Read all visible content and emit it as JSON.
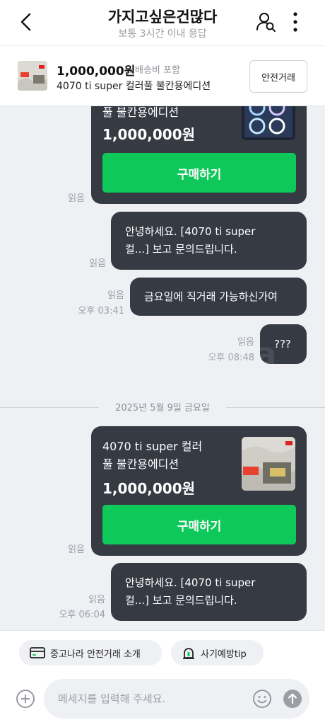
{
  "header": {
    "title": "가지고싶은건많다",
    "subtitle": "보통 3시간 이내 응답"
  },
  "product": {
    "price": "1,000,000원",
    "shipping": "배송비 포함",
    "title": "4070 ti super 컬러풀 불칸용에디션",
    "safe_button": "안전거래"
  },
  "messages": {
    "card1": {
      "name_line2": "풀 불칸용에디션",
      "price": "1,000,000원",
      "buy": "구매하기",
      "read": "읽음"
    },
    "msg1": {
      "line1": "안녕하세요. [4070 ti super",
      "line2": "컬...] 보고 문의드립니다.",
      "read": "읽음"
    },
    "msg2": {
      "text": "금요일에 직거래 가능하신가여",
      "read": "읽음",
      "time": "오후 03:41"
    },
    "msg3": {
      "text": "???",
      "read": "읽음",
      "time": "오후 08:48"
    },
    "date_divider": "2025년 5월 9일 금요일",
    "card2": {
      "name_line1": "4070 ti super 컬러",
      "name_line2": "풀 불칸용에디션",
      "price": "1,000,000원",
      "buy": "구매하기",
      "read": "읽음"
    },
    "msg4": {
      "line1": "안녕하세요. [4070 ti super",
      "line2": "컬...] 보고 문의드립니다.",
      "read": "읽음",
      "time": "오후 06:04"
    }
  },
  "watermark": "Joonggonara",
  "bottom": {
    "chip_safe": "중고나라 안전거래 소개",
    "chip_fraud": "사기예방tip",
    "input_placeholder": "메세지를 입력해 주세요."
  },
  "colors": {
    "bubble": "#353a43",
    "buy_button": "#0ec85a",
    "background": "#eef0f4"
  },
  "icons": [
    "back-arrow-icon",
    "user-search-icon",
    "more-vertical-icon",
    "card-icon",
    "siren-icon",
    "plus-circle-icon",
    "emoji-icon",
    "send-arrow-icon"
  ]
}
